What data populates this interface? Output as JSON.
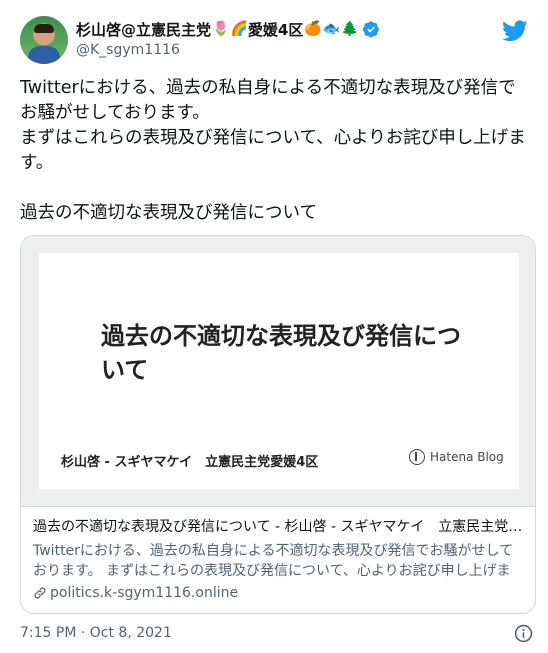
{
  "user": {
    "display_name": "杉山啓@立憲民主党",
    "name_suffix": "愛媛4区",
    "handle": "@K_sgym1116",
    "emojis": [
      "🌷",
      "🌈",
      "🍊",
      "🐟",
      "🌲"
    ]
  },
  "tweet": {
    "text": "Twitterにおける、過去の私自身による不適切な表現及び発信でお騒がせしております。\nまずはこれらの表現及び発信について、心よりお詫び申し上げます。\n\n過去の不適切な表現及び発信について",
    "timestamp": "7:15 PM · Oct 8, 2021"
  },
  "card": {
    "image_title": "過去の不適切な表現及び発信について",
    "image_author": "杉山啓 - スギヤマケイ　立憲民主党愛媛4区",
    "image_brand": "Hatena Blog",
    "headline": "過去の不適切な表現及び発信について - 杉山啓 - スギヤマケイ　立憲民主党愛媛4区",
    "description": "Twitterにおける、過去の私自身による不適切な表現及び発信でお騒がせしております。 まずはこれらの表現及び発信について、心よりお詫び申し上げます。",
    "domain": "politics.k-sgym1116.online"
  },
  "colors": {
    "brand_blue": "#1d9bf0",
    "text_primary": "#0f1419",
    "text_secondary": "#536471",
    "border": "#cfd9de"
  },
  "icons": {
    "logo": "twitter-bird-icon",
    "verified": "verified-badge-icon",
    "link": "link-icon",
    "info": "info-icon"
  }
}
